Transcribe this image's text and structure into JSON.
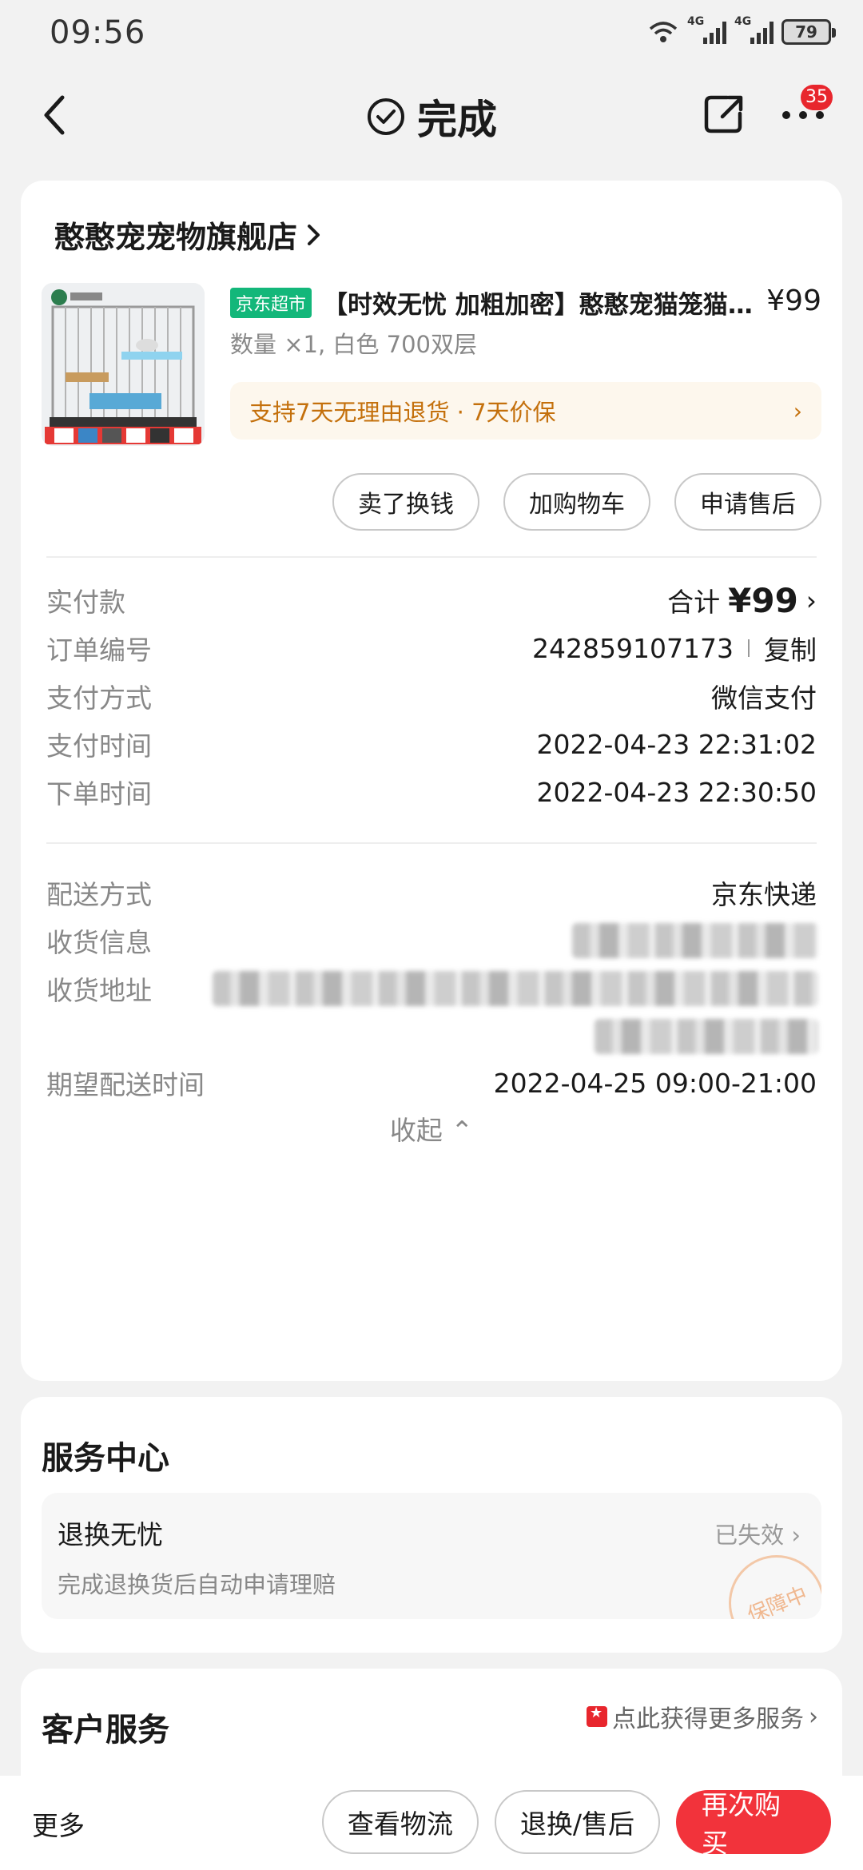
{
  "status_bar": {
    "time": "09:56",
    "battery": "79",
    "net1": "4G",
    "net2": "4G"
  },
  "header": {
    "title": "完成",
    "badge_count": "35"
  },
  "store": {
    "name": "憨憨宠宠物旗舰店"
  },
  "product": {
    "tag": "京东超市",
    "name": "【时效无忧 加粗加密】憨憨宠猫笼猫别墅",
    "price": "¥99",
    "spec": "数量 ×1, 白色 700双层",
    "service": "支持7天无理由退货 · 7天价保"
  },
  "product_actions": [
    "卖了换钱",
    "加购物车",
    "申请售后"
  ],
  "order_info": {
    "paid": {
      "label": "实付款",
      "prefix": "合计",
      "amount": "¥99"
    },
    "order_no": {
      "label": "订单编号",
      "value": "242859107173",
      "copy": "复制"
    },
    "pay_method": {
      "label": "支付方式",
      "value": "微信支付"
    },
    "pay_time": {
      "label": "支付时间",
      "value": "2022-04-23 22:31:02"
    },
    "order_time": {
      "label": "下单时间",
      "value": "2022-04-23 22:30:50"
    },
    "delivery_method": {
      "label": "配送方式",
      "value": "京东快递"
    },
    "receiver": {
      "label": "收货信息"
    },
    "address": {
      "label": "收货地址"
    },
    "expected_time": {
      "label": "期望配送时间",
      "value": "2022-04-25 09:00-21:00"
    },
    "collapse": "收起"
  },
  "service_center": {
    "title": "服务中心",
    "item": {
      "name": "退换无忧",
      "status": "已失效",
      "desc": "完成退换货后自动申请理赔",
      "stamp": "保障中"
    }
  },
  "customer_service": {
    "title": "客户服务",
    "link": "点此获得更多服务"
  },
  "bottom_bar": {
    "more": "更多",
    "logistics": "查看物流",
    "after_sale": "退换/售后",
    "rebuy": "再次购买"
  },
  "colors": {
    "accent_red": "#f2333b",
    "jd_green": "#13b77a",
    "service_orange": "#c4700c"
  }
}
